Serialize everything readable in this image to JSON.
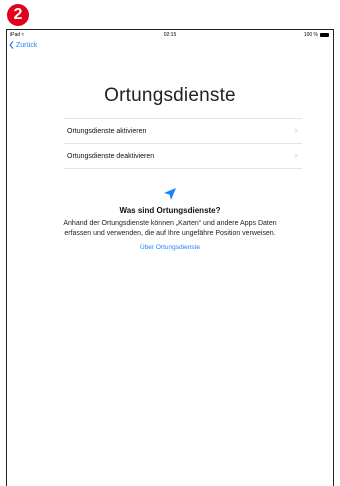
{
  "step": {
    "number": "2",
    "color": "#e2001a"
  },
  "statusbar": {
    "left": "iPad",
    "time": "02:15",
    "battery": "100 %"
  },
  "nav": {
    "back_label": "Zurück",
    "accent_color": "#1a82fb"
  },
  "title": "Ortungsdienste",
  "options": [
    {
      "label": "Ortungsdienste aktivieren",
      "icon": "chevron-right-icon"
    },
    {
      "label": "Ortungsdienste deaktivieren",
      "icon": "chevron-right-icon"
    }
  ],
  "info": {
    "icon": "location-arrow-icon",
    "heading": "Was sind Ortungsdienste?",
    "body": "Anhand der Ortungsdienste können „Karten“ und andere Apps Daten erfassen und verwenden, die auf Ihre ungefähre Position verweisen.",
    "link": "Über Ortungsdienste"
  }
}
